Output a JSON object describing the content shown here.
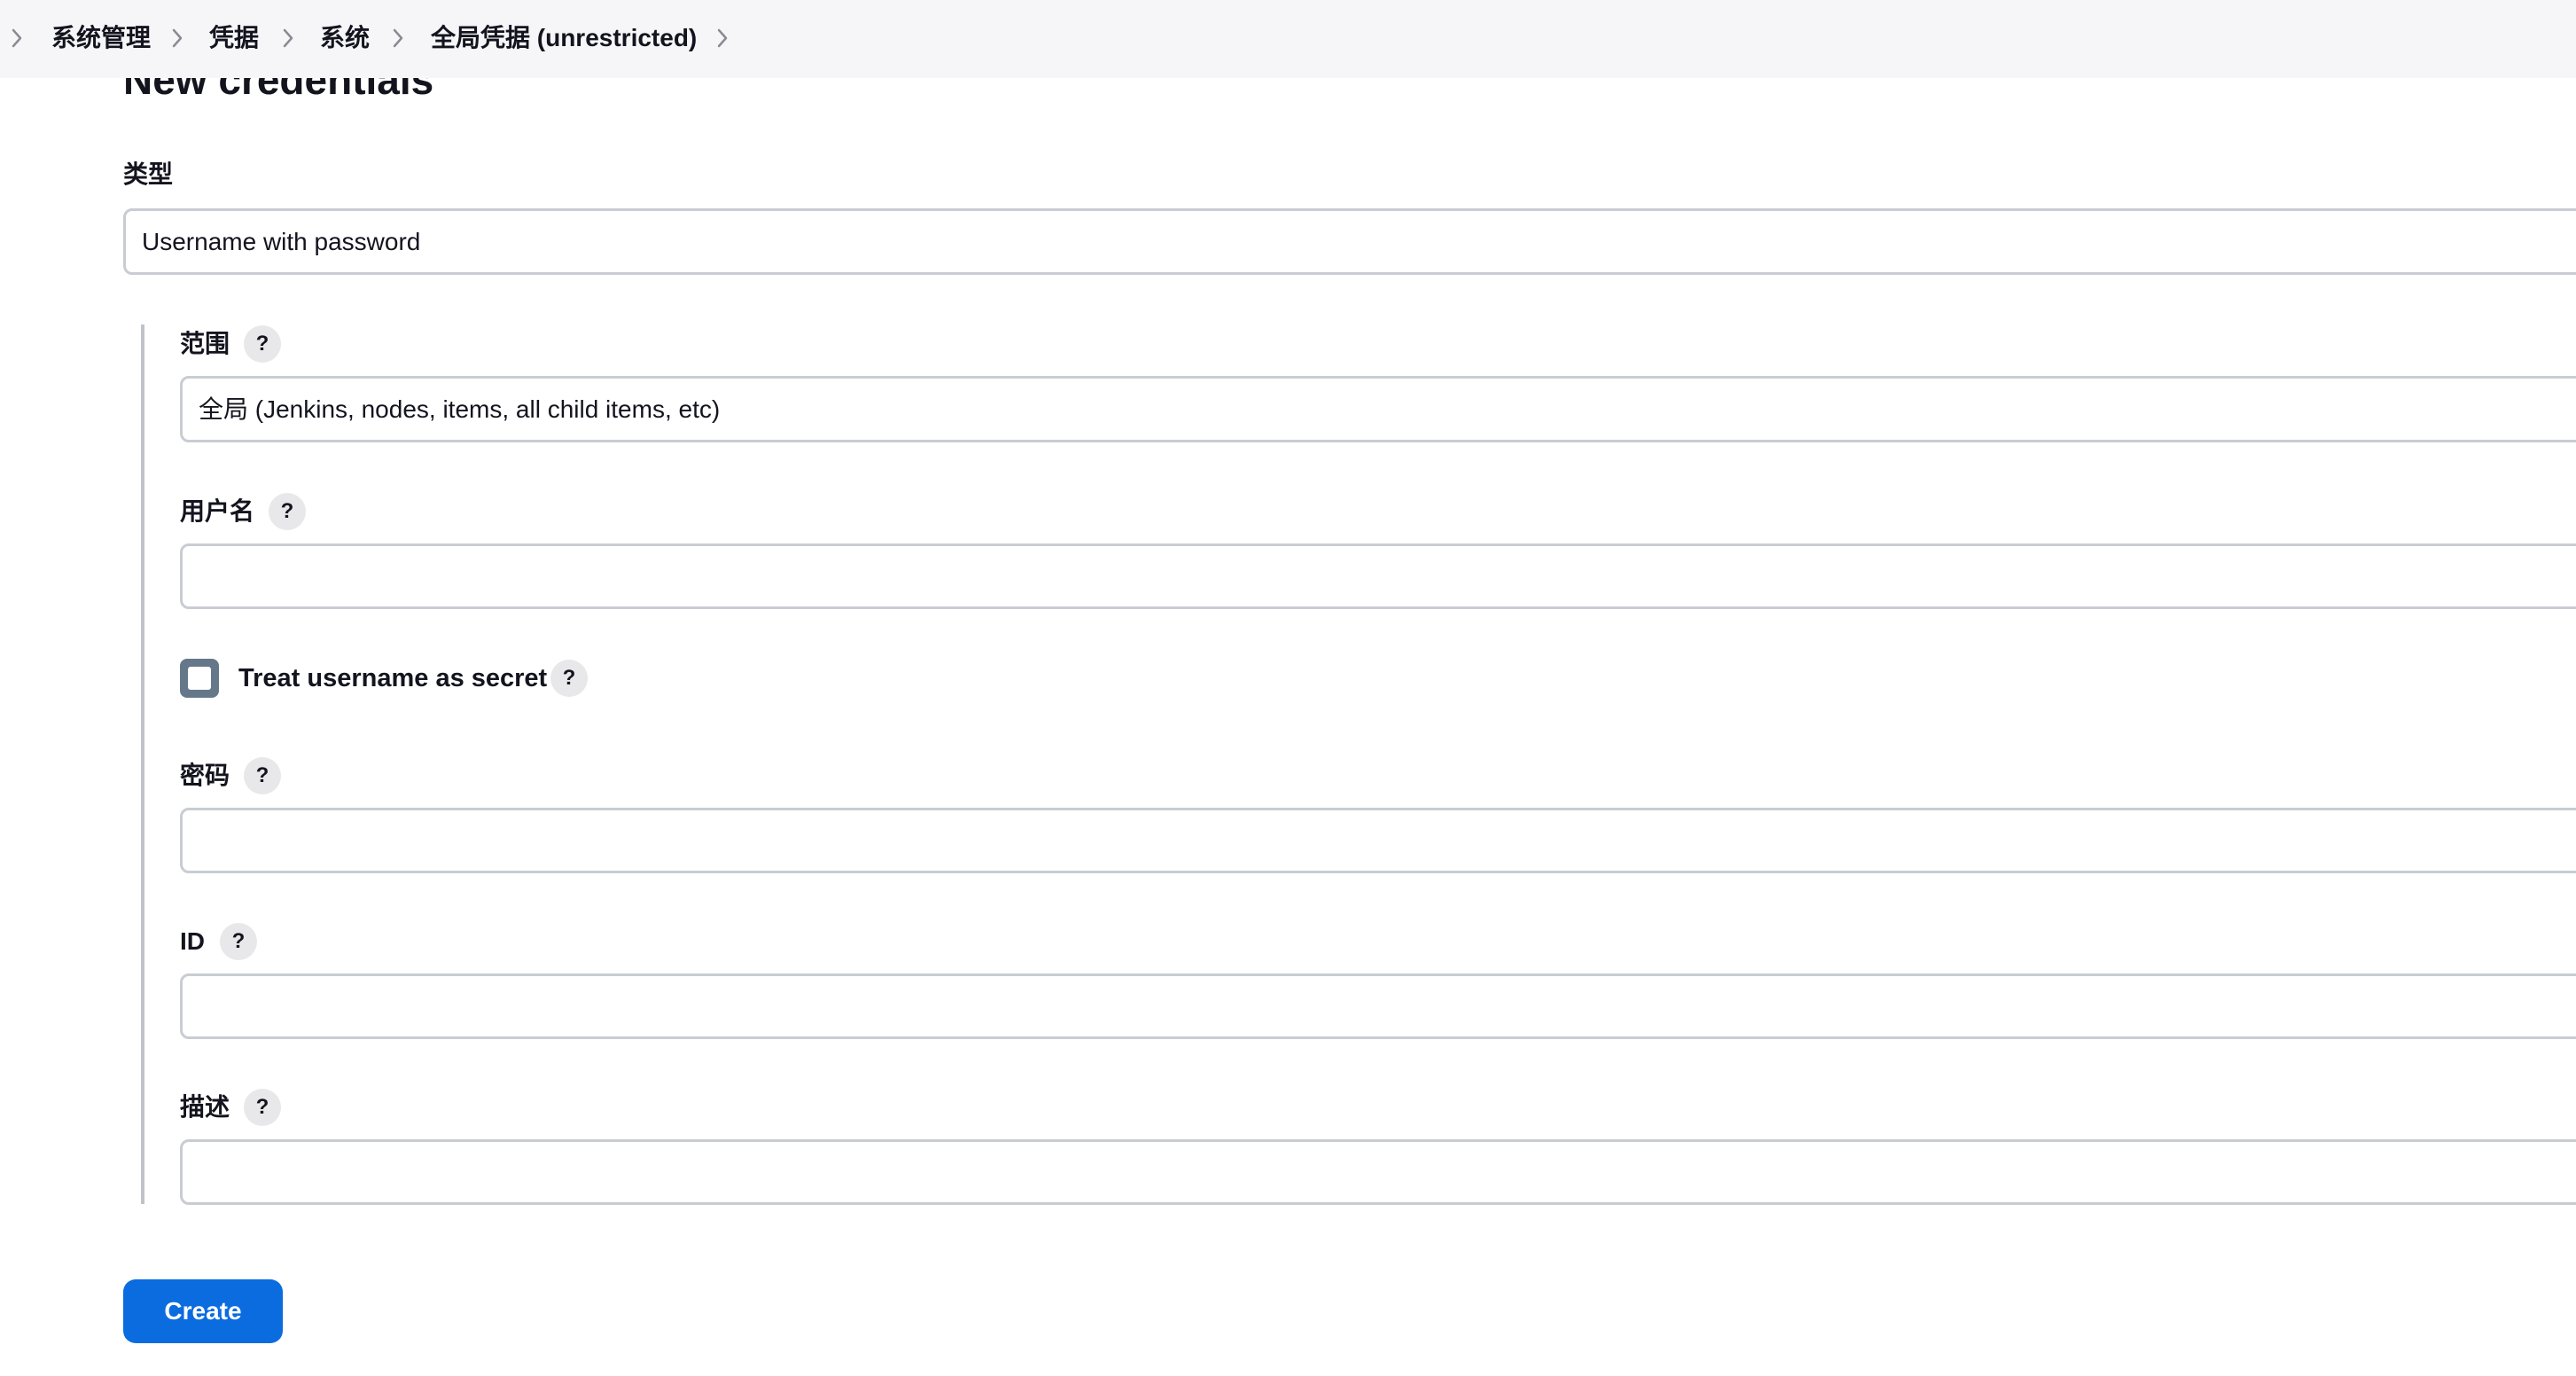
{
  "breadcrumb": {
    "items": [
      "系统管理",
      "凭据",
      "系统",
      "全局凭据 (unrestricted)"
    ]
  },
  "page": {
    "title": "New credentials"
  },
  "form": {
    "kind_label": "类型",
    "kind_value": "Username with password",
    "scope_label": "范围",
    "scope_value": "全局 (Jenkins, nodes, items, all child items, etc)",
    "username_label": "用户名",
    "username_value": "",
    "treat_secret_label": "Treat username as secret",
    "treat_secret_checked": false,
    "password_label": "密码",
    "password_value": "",
    "id_label": "ID",
    "id_value": "",
    "description_label": "描述",
    "description_value": "",
    "help_glyph": "?",
    "create_label": "Create"
  },
  "colors": {
    "primary": "#0b6ce0",
    "checkbox": "#64788a",
    "border": "#c9ccd3",
    "breadcrumb_bg": "#f6f6f8"
  }
}
